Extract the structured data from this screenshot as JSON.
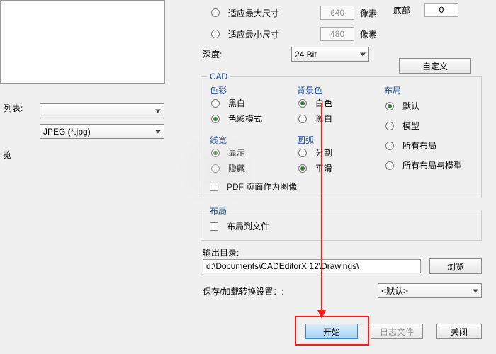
{
  "left": {
    "list_label": "列表:",
    "format_selected": "JPEG (*.jpg)",
    "preview_label": "览"
  },
  "size": {
    "fit_max": "适应最大尺寸",
    "fit_min": "适应最小尺寸",
    "px": "像素",
    "w": "640",
    "h": "480",
    "depth_label": "深度:",
    "depth_value": "24 Bit"
  },
  "margin": {
    "bottom_label": "底部",
    "bottom_value": "0"
  },
  "custom_btn": "自定义",
  "cad": {
    "title": "CAD",
    "color_title": "色彩",
    "color_bw": "黑白",
    "color_mode": "色彩模式",
    "bg_title": "背景色",
    "bg_white": "白色",
    "bg_black": "黑白",
    "layout_title": "布局",
    "layout_default": "默认",
    "layout_model": "模型",
    "layout_all": "所有布局",
    "layout_allmodel": "所有布局与模型",
    "lw_title": "线宽",
    "lw_show": "显示",
    "lw_hide": "隐藏",
    "arc_title": "圆弧",
    "arc_split": "分割",
    "arc_smooth": "平滑",
    "pdf_page": "PDF 页面作为图像"
  },
  "layoutgrp": {
    "title": "布局",
    "tofile": "布局到文件"
  },
  "out": {
    "label": "输出目录:",
    "path": "d:\\Documents\\CADEditorX 12\\Drawings\\",
    "browse": "浏览"
  },
  "preset": {
    "label": "保存/加载转换设置：:",
    "value": "<默认>"
  },
  "footer": {
    "start": "开始",
    "log": "日志文件",
    "close": "关闭"
  }
}
